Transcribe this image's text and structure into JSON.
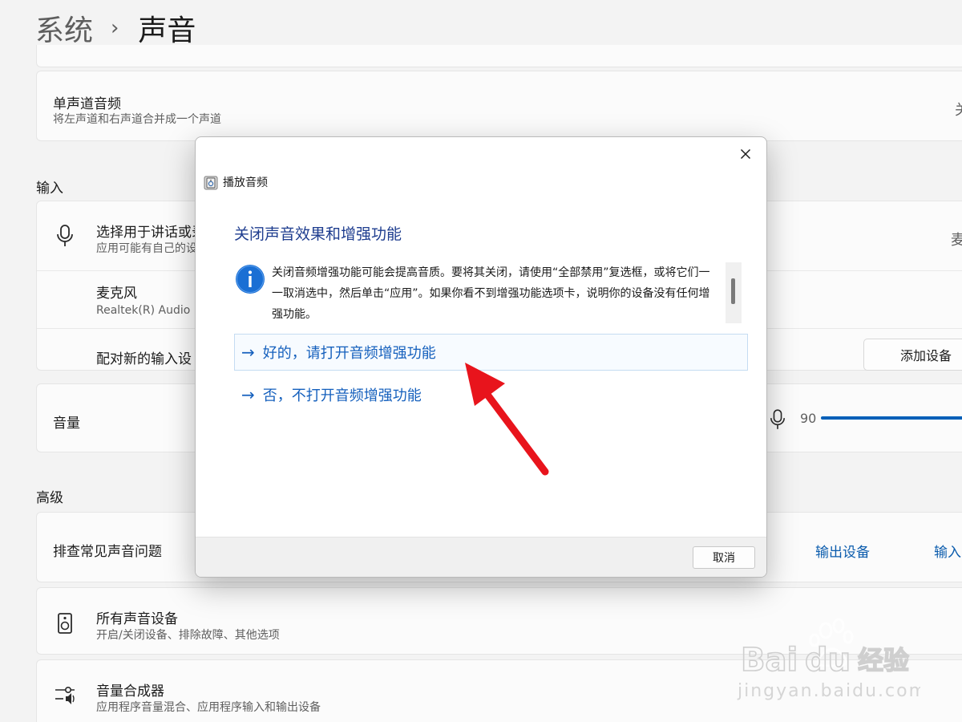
{
  "breadcrumb": {
    "parent": "系统",
    "separator": "›",
    "current": "声音"
  },
  "mono_audio": {
    "title": "单声道音频",
    "description": "将左声道和右声道合并成一个声道",
    "value": "关"
  },
  "sections": {
    "input": "输入",
    "advanced": "高级"
  },
  "input": {
    "choose_device": {
      "title": "选择用于讲话或录制",
      "description": "应用可能有自己的设",
      "value": "麦"
    },
    "microphone": {
      "title": "麦克风",
      "description": "Realtek(R) Audio"
    },
    "pair_new": {
      "title": "配对新的输入设",
      "button": "添加设备"
    }
  },
  "volume": {
    "title": "音量",
    "value": "90",
    "level_percent": 90
  },
  "troubleshoot": {
    "title": "排查常见声音问题",
    "link_output": "输出设备",
    "link_input": "输入"
  },
  "all_devices": {
    "title": "所有声音设备",
    "description": "开启/关闭设备、排除故障、其他选项"
  },
  "mixer": {
    "title": "音量合成器",
    "description": "应用程序音量混合、应用程序输入和输出设备"
  },
  "dialog": {
    "app_title": "播放音频",
    "heading": "关闭声音效果和增强功能",
    "info_text": "关闭音频增强功能可能会提高音质。要将其关闭，请使用“全部禁用”复选框，或将它们一一取消选中，然后单击“应用”。如果你看不到增强功能选项卡，说明你的设备没有任何增强功能。",
    "option_yes": "好的，请打开音频增强功能",
    "option_no": "否，不打开音频增强功能",
    "arrow_glyph": "→",
    "cancel": "取消"
  },
  "icons": {
    "mic": "microphone-icon",
    "speaker_box": "speaker-device-icon",
    "mixer": "volume-mixer-icon",
    "close": "close-icon",
    "info": "info-icon"
  },
  "watermark": {
    "brand": "Bai du 经验",
    "url": "jingyan.baidu.com"
  },
  "colors": {
    "accent": "#005fb8",
    "link": "#1560bd",
    "annotation": "#e8141c"
  }
}
